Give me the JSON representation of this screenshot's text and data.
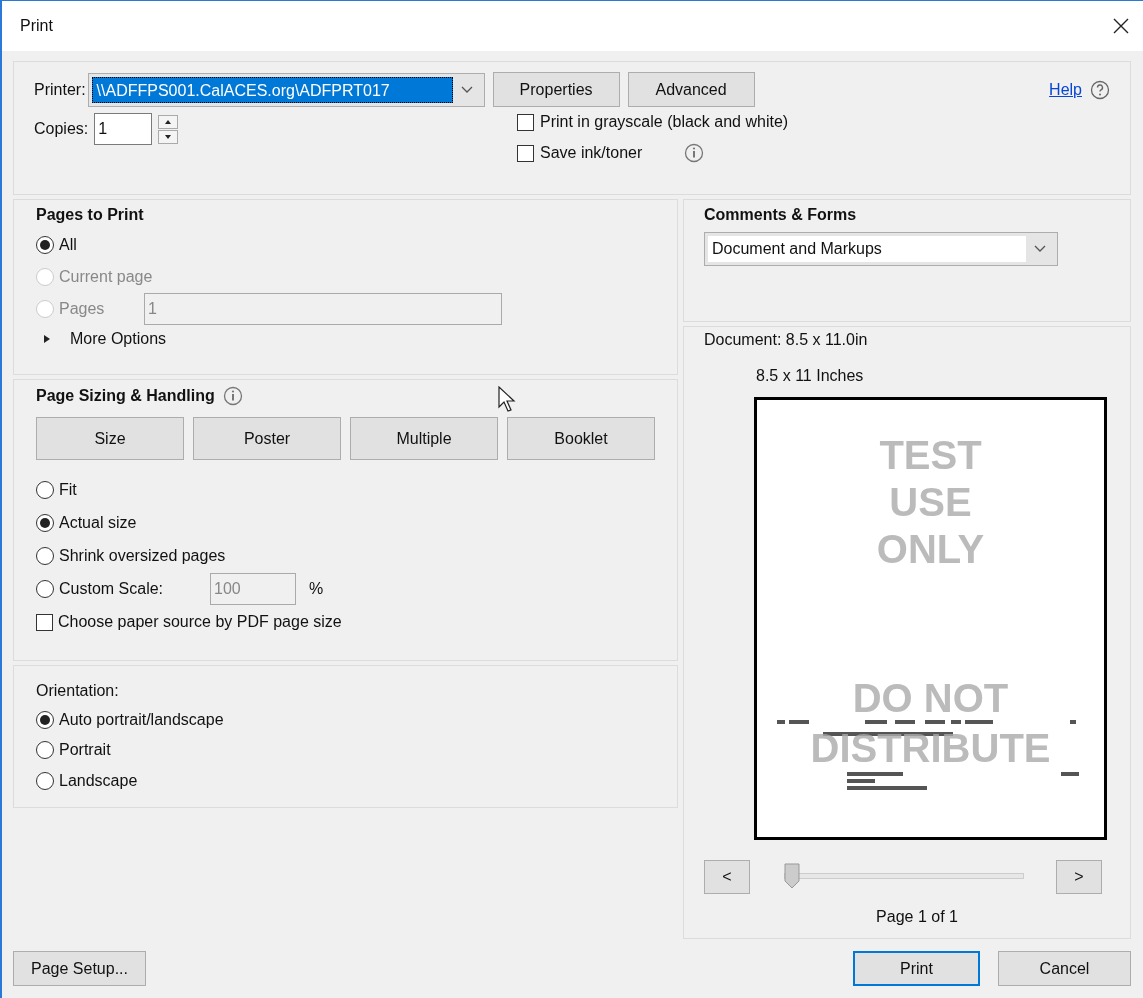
{
  "window": {
    "title": "Print"
  },
  "printer": {
    "label": "Printer:",
    "value": "\\\\ADFFPS001.CalACES.org\\ADFPRT017",
    "buttons": [
      "Properties",
      "Advanced"
    ]
  },
  "help": {
    "label": "Help"
  },
  "copies": {
    "label": "Copies:",
    "value": "1"
  },
  "options": [
    {
      "label": "Print in grayscale (black and white)",
      "checked": false,
      "info": false
    },
    {
      "label": "Save ink/toner",
      "checked": false,
      "info": true
    }
  ],
  "pages_to_print": {
    "title": "Pages to Print",
    "choices": [
      {
        "kind": "plain",
        "label": "All",
        "selected": true,
        "disabled": false
      },
      {
        "kind": "plain",
        "label": "Current page",
        "selected": false,
        "disabled": true
      },
      {
        "kind": "field",
        "label": "Pages",
        "selected": false,
        "disabled": true,
        "value": "1"
      }
    ],
    "more_options": {
      "label": "More Options",
      "expanded": false
    }
  },
  "page_sizing": {
    "title": "Page Sizing & Handling",
    "modes": [
      "Size",
      "Poster",
      "Multiple",
      "Booklet"
    ],
    "choices": [
      {
        "kind": "plain",
        "label": "Fit",
        "selected": false
      },
      {
        "kind": "plain",
        "label": "Actual size",
        "selected": true
      },
      {
        "kind": "plain",
        "label": "Shrink oversized pages",
        "selected": false
      },
      {
        "kind": "scale",
        "label": "Custom Scale:",
        "selected": false,
        "value": "100",
        "unit": "%"
      }
    ],
    "paper_source": {
      "label": "Choose paper source by PDF page size",
      "checked": false
    }
  },
  "orientation": {
    "title": "Orientation:",
    "choices": [
      {
        "label": "Auto portrait/landscape",
        "selected": true
      },
      {
        "label": "Portrait",
        "selected": false
      },
      {
        "label": "Landscape",
        "selected": false
      }
    ]
  },
  "comments_forms": {
    "title": "Comments & Forms",
    "value": "Document and Markups"
  },
  "preview": {
    "document": "Document: 8.5 x 11.0in",
    "paper": "8.5 x 11 Inches",
    "watermark_top": [
      "TEST",
      "USE",
      "ONLY"
    ],
    "watermark_bottom": [
      "DO NOT",
      "DISTRIBUTE"
    ],
    "prev": "<",
    "next": ">",
    "level": 0,
    "page": "Page 1 of 1"
  },
  "footer": {
    "page_setup": "Page Setup...",
    "print": "Print",
    "cancel": "Cancel"
  }
}
